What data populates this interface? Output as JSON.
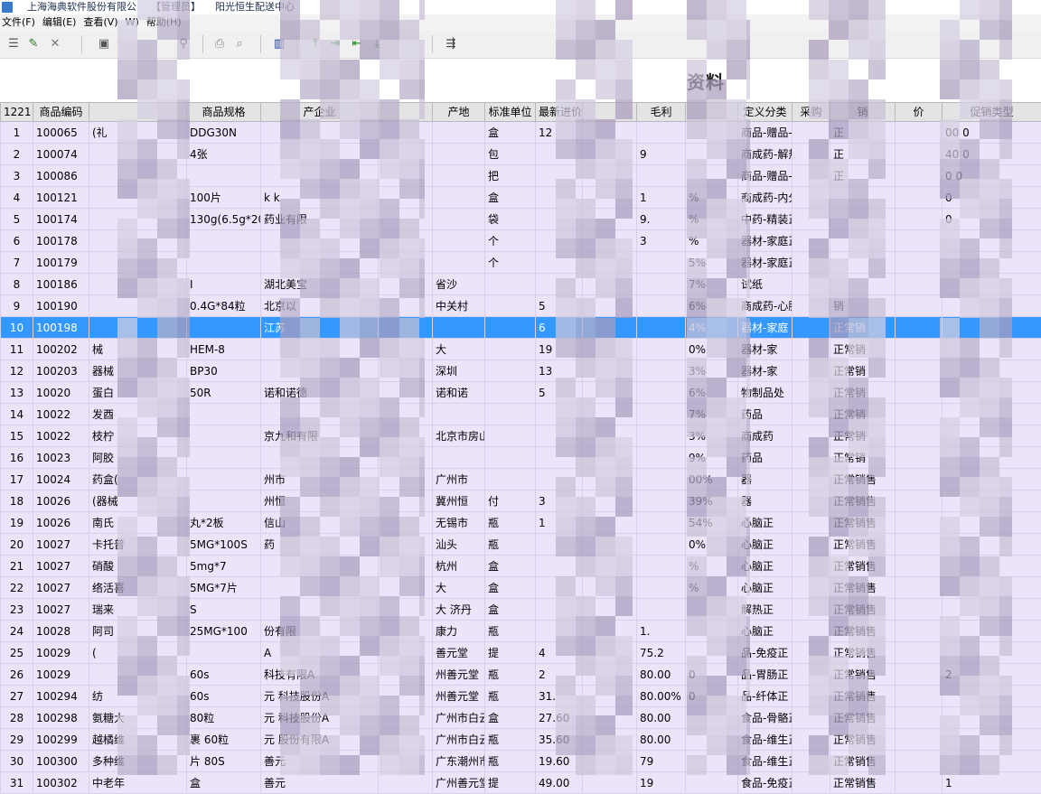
{
  "titlebar": {
    "company": "上海海典软件股份有限公",
    "role": "【管理员】",
    "center": "阳光恒生配送中心"
  },
  "menu": [
    "文件(F)",
    "编辑(E)",
    "查看(V)",
    "W)",
    "帮助(H)"
  ],
  "toolbar": {
    "icons": [
      "list-icon",
      "edit-icon",
      "delete-icon",
      "save-icon",
      "binoculars-icon",
      "print-icon",
      "preview-icon",
      "chart-icon",
      "first-icon",
      "prev-icon",
      "next-icon",
      "last-icon",
      "export-icon"
    ]
  },
  "heading": "资料",
  "grid": {
    "columns": [
      "1221",
      "商品编码",
      "",
      "商品规格",
      "产企业",
      "",
      "产地",
      "标准单位",
      "最新进价",
      "",
      "毛利",
      "",
      "定义分类",
      "采购",
      "销",
      "价",
      "促销类型"
    ],
    "rows": [
      {
        "n": "1",
        "code": "100065",
        "name": "(礼",
        "spec": "DDG30N",
        "mfr": "",
        "origin": "",
        "unit": "盒",
        "price": "12",
        "margin": "",
        "rate": "",
        "cat": "商品-赠品-正常",
        "status": "正",
        "extra": "00 0"
      },
      {
        "n": "2",
        "code": "100074",
        "name": "",
        "spec": "4张",
        "mfr": "",
        "origin": "",
        "unit": "包",
        "price": "",
        "margin": "9",
        "rate": "",
        "cat": "商成药-解热正常",
        "status": "正",
        "extra": "40 0"
      },
      {
        "n": "3",
        "code": "100086",
        "name": "",
        "spec": "",
        "mfr": "",
        "origin": "",
        "unit": "把",
        "price": "",
        "margin": "",
        "rate": "",
        "cat": "商品-赠品-正常",
        "status": "正",
        "extra": "0 0"
      },
      {
        "n": "4",
        "code": "100121",
        "name": "",
        "spec": "100片",
        "mfr": "k k",
        "origin": "",
        "unit": "盒",
        "price": "",
        "margin": "1",
        "rate": "%",
        "cat": "商成药-内分正常",
        "status": "",
        "extra": "0"
      },
      {
        "n": "5",
        "code": "100174",
        "name": "",
        "spec": "130g(6.5g*20",
        "mfr": "药业有限",
        "origin": "",
        "unit": "袋",
        "price": "",
        "margin": "9.",
        "rate": "%",
        "cat": "中药-精装正常",
        "status": "",
        "extra": "0"
      },
      {
        "n": "6",
        "code": "100178",
        "name": "",
        "spec": "",
        "mfr": "",
        "origin": "",
        "unit": "个",
        "price": "",
        "margin": "3",
        "rate": "%",
        "cat": "器材-家庭正",
        "status": "",
        "extra": ""
      },
      {
        "n": "7",
        "code": "100179",
        "name": "",
        "spec": "",
        "mfr": "",
        "origin": "",
        "unit": "个",
        "price": "",
        "margin": "",
        "rate": "5%",
        "cat": "器材-家庭正",
        "status": "",
        "extra": ""
      },
      {
        "n": "8",
        "code": "100186",
        "name": "",
        "spec": "I",
        "mfr": "湖北美宝",
        "origin": "省沙",
        "unit": "",
        "price": "",
        "margin": "",
        "rate": "7%",
        "cat": "试纸",
        "status": "",
        "extra": ""
      },
      {
        "n": "9",
        "code": "100190",
        "name": "",
        "spec": "0.4G*84粒",
        "mfr": "北京以",
        "origin": "中关村",
        "unit": "",
        "price": "5",
        "margin": "",
        "rate": "6%",
        "cat": "商成药-心脑",
        "status": "销",
        "extra": ""
      },
      {
        "n": "10",
        "code": "100198",
        "name": "",
        "spec": "",
        "mfr": "江苏",
        "origin": "",
        "unit": "",
        "price": "6",
        "margin": "",
        "rate": "4%",
        "cat": "器材-家庭",
        "status": "正常销",
        "extra": ""
      },
      {
        "n": "11",
        "code": "100202",
        "name": "械",
        "spec": "HEM-8",
        "mfr": "",
        "origin": "大",
        "unit": "",
        "price": "19",
        "margin": "",
        "rate": "0%",
        "cat": "器材-家",
        "status": "正常销",
        "extra": ""
      },
      {
        "n": "12",
        "code": "100203",
        "name": "器械",
        "spec": "BP30",
        "mfr": "",
        "origin": "深圳",
        "unit": "",
        "price": "13",
        "margin": "",
        "rate": "3%",
        "cat": "器材-家",
        "status": "正常销",
        "extra": ""
      },
      {
        "n": "13",
        "code": "10020",
        "name": "蛋白",
        "spec": "50R",
        "mfr": "诺和诺德",
        "origin": "诺和诺",
        "unit": "",
        "price": "5",
        "margin": "",
        "rate": "6%",
        "cat": "物制品处",
        "status": "正常销",
        "extra": ""
      },
      {
        "n": "14",
        "code": "10022",
        "name": "发酉",
        "spec": "",
        "mfr": "",
        "origin": "",
        "unit": "",
        "price": "",
        "margin": "",
        "rate": "7%",
        "cat": "药品",
        "status": "正常销",
        "extra": ""
      },
      {
        "n": "15",
        "code": "10022",
        "name": "枝柠",
        "spec": "",
        "mfr": "京九和有限",
        "origin": "北京市房山",
        "unit": "",
        "price": "",
        "margin": "",
        "rate": "3%",
        "cat": "商成药",
        "status": "正常销",
        "extra": ""
      },
      {
        "n": "16",
        "code": "10023",
        "name": "阿胶",
        "spec": "",
        "mfr": "",
        "origin": "",
        "unit": "",
        "price": "",
        "margin": "",
        "rate": "9%",
        "cat": "药品",
        "status": "正常销",
        "extra": ""
      },
      {
        "n": "17",
        "code": "10024",
        "name": "药盒(",
        "spec": "",
        "mfr": "州市",
        "origin": "广州市",
        "unit": "",
        "price": "",
        "margin": "",
        "rate": "00%",
        "cat": "器",
        "status": "正常销售",
        "extra": ""
      },
      {
        "n": "18",
        "code": "10026",
        "name": "(器械",
        "spec": "",
        "mfr": "州恒",
        "origin": "冀州恒",
        "unit": "付",
        "price": "3",
        "margin": "",
        "rate": "39%",
        "cat": "器",
        "status": "正常销售",
        "extra": ""
      },
      {
        "n": "19",
        "code": "10026",
        "name": "南氏",
        "spec": "丸*2板",
        "mfr": "信山",
        "origin": "无锡市",
        "unit": "瓶",
        "price": "1",
        "margin": "",
        "rate": "54%",
        "cat": "心脑正",
        "status": "正常销售",
        "extra": ""
      },
      {
        "n": "20",
        "code": "10027",
        "name": "卡托普",
        "spec": "5MG*100S",
        "mfr": "药",
        "origin": "汕头",
        "unit": "瓶",
        "price": "",
        "margin": "",
        "rate": "0%",
        "cat": "心脑正",
        "status": "正常销售",
        "extra": ""
      },
      {
        "n": "21",
        "code": "10027",
        "name": "硝酸",
        "spec": "5mg*7",
        "mfr": "",
        "origin": "杭州",
        "unit": "盒",
        "price": "",
        "margin": "",
        "rate": "%",
        "cat": "心脑正",
        "status": "正常销售",
        "extra": ""
      },
      {
        "n": "22",
        "code": "10027",
        "name": "络活喜",
        "spec": "5MG*7片",
        "mfr": "",
        "origin": "大",
        "unit": "盒",
        "price": "",
        "margin": "",
        "rate": "%",
        "cat": "心脑正",
        "status": "正常销售",
        "extra": ""
      },
      {
        "n": "23",
        "code": "10027",
        "name": "瑞来",
        "spec": "S",
        "mfr": "",
        "origin": "大 济丹",
        "unit": "盒",
        "price": "",
        "margin": "",
        "rate": "",
        "cat": "解热正",
        "status": "正常销售",
        "extra": ""
      },
      {
        "n": "24",
        "code": "10028",
        "name": "阿司",
        "spec": "25MG*100",
        "mfr": "份有限",
        "origin": "康力",
        "unit": "瓶",
        "price": "",
        "margin": "1.",
        "rate": "",
        "cat": "心脑正",
        "status": "正常销售",
        "extra": ""
      },
      {
        "n": "25",
        "code": "10029",
        "name": "(",
        "spec": "",
        "mfr": "A",
        "origin": "善元堂",
        "unit": "提",
        "price": "4",
        "margin": "75.2",
        "rate": "",
        "cat": "品-免疫正",
        "status": "正常销售",
        "extra": ""
      },
      {
        "n": "26",
        "code": "10029",
        "name": "",
        "spec": "60s",
        "mfr": "科技有限A",
        "origin": "州善元堂",
        "unit": "瓶",
        "price": "2",
        "margin": "80.00",
        "rate": "0",
        "cat": "品-胃肠正",
        "status": "正常销售",
        "extra": "2"
      },
      {
        "n": "27",
        "code": "100294",
        "name": "纺",
        "spec": "60s",
        "mfr": "元 科技股份A",
        "origin": "州善元堂",
        "unit": "瓶",
        "price": "31.",
        "margin": "80.00%",
        "rate": "0",
        "cat": "品-纤体正",
        "status": "正常销售",
        "extra": ""
      },
      {
        "n": "28",
        "code": "100298",
        "name": "氨糖大",
        "spec": "80粒",
        "mfr": "元 科技股份A",
        "origin": "广州市白云",
        "unit": "盒",
        "price": "27.60",
        "margin": "80.00",
        "rate": "",
        "cat": "食品-骨骼正",
        "status": "正常销售",
        "extra": ""
      },
      {
        "n": "29",
        "code": "100299",
        "name": "越橘维",
        "spec": "裹 60粒",
        "mfr": "元 股份有限A",
        "origin": "广州市白云",
        "unit": "瓶",
        "price": "35.60",
        "margin": "80.00",
        "rate": "",
        "cat": "食品-维生正",
        "status": "正常销售",
        "extra": ""
      },
      {
        "n": "30",
        "code": "100300",
        "name": "多种维",
        "spec": "片 80S",
        "mfr": "善元",
        "origin": "广东潮州市",
        "unit": "瓶",
        "price": "19.60",
        "margin": "79",
        "rate": "",
        "cat": "食品-维生正",
        "status": "正常销售",
        "extra": ""
      },
      {
        "n": "31",
        "code": "100302",
        "name": "中老年",
        "spec": "盒",
        "mfr": "善元",
        "origin": "广州善元堂",
        "unit": "提",
        "price": "49.00",
        "margin": "19",
        "rate": "",
        "cat": "食品-免疫正",
        "status": "正常销售",
        "extra": "1"
      }
    ]
  }
}
